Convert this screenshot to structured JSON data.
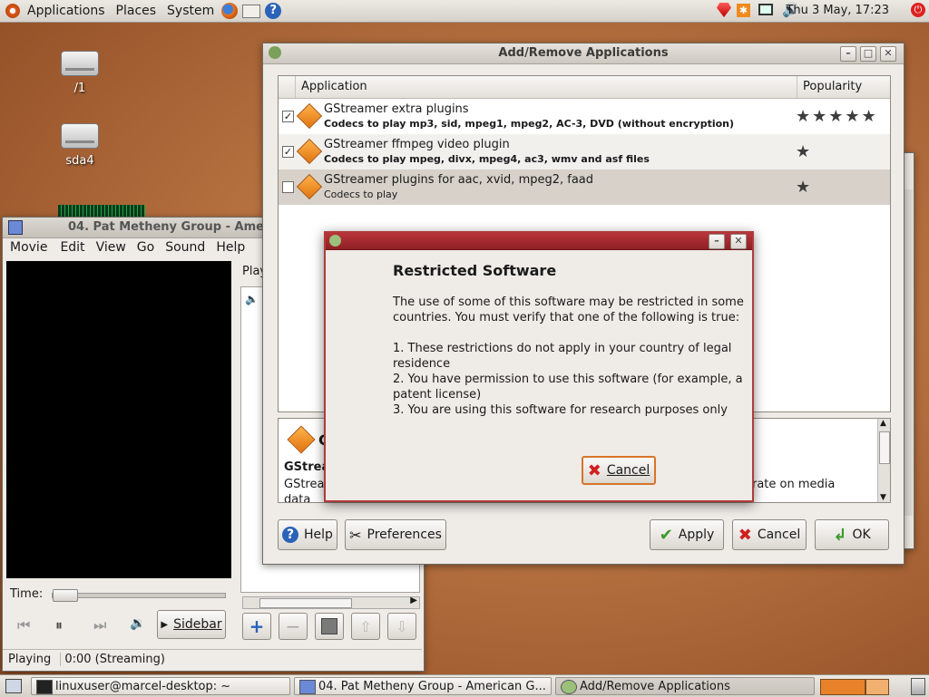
{
  "top_panel": {
    "menus": [
      "Applications",
      "Places",
      "System"
    ],
    "clock": "Thu  3 May, 17:23"
  },
  "desktop": {
    "icons": [
      {
        "label": "/1"
      },
      {
        "label": "sda4"
      }
    ]
  },
  "totem": {
    "title": "04. Pat Metheny Group - Ameri",
    "menus": [
      "Movie",
      "Edit",
      "View",
      "Go",
      "Sound",
      "Help"
    ],
    "playlist_label": "Play",
    "time_label": "Time:",
    "sidebar_label": "Sidebar",
    "status": "Playing",
    "status_time": "0:00 (Streaming)"
  },
  "addremove": {
    "title": "Add/Remove Applications",
    "columns": [
      "Application",
      "Popularity"
    ],
    "rows": [
      {
        "checked": true,
        "name": "GStreamer extra plugins",
        "desc": "Codecs to play mp3, sid, mpeg1, mpeg2, AC-3, DVD (without encryption)",
        "stars": 5
      },
      {
        "checked": true,
        "name": "GStreamer ffmpeg video plugin",
        "desc": "Codecs to play mpeg, divx, mpeg4, ac3, wmv and asf files",
        "stars": 1
      },
      {
        "checked": false,
        "name": "GStreamer plugins for aac, xvid, mpeg2, faad",
        "desc": "Codecs to play",
        "stars": 1
      }
    ],
    "detail_title_frag": "G",
    "detail_heading_frag": "GStrea",
    "detail_body_frag": "GStrea",
    "detail_body_right": "rate on media",
    "detail_body_line2": "data",
    "buttons": {
      "help": "Help",
      "preferences": "Preferences",
      "apply": "Apply",
      "cancel": "Cancel",
      "ok": "OK"
    }
  },
  "dialog": {
    "heading": "Restricted Software",
    "p1": "The use of some of this software may be restricted in some countries.  You must verify that one of the following is true:",
    "item1": "1. These restrictions do not apply in your country of legal residence",
    "item2": "2. You have permission to use this software (for example, a patent license)",
    "item3": "3. You are using this software for research purposes only",
    "cancel": "Cancel"
  },
  "taskbar": {
    "tasks": [
      "linuxuser@marcel-desktop: ~",
      "04. Pat Metheny Group - American G...",
      "Add/Remove Applications"
    ]
  },
  "colors": {
    "dialog_accent": "#b03a3a",
    "star": "#3d3d3d"
  }
}
